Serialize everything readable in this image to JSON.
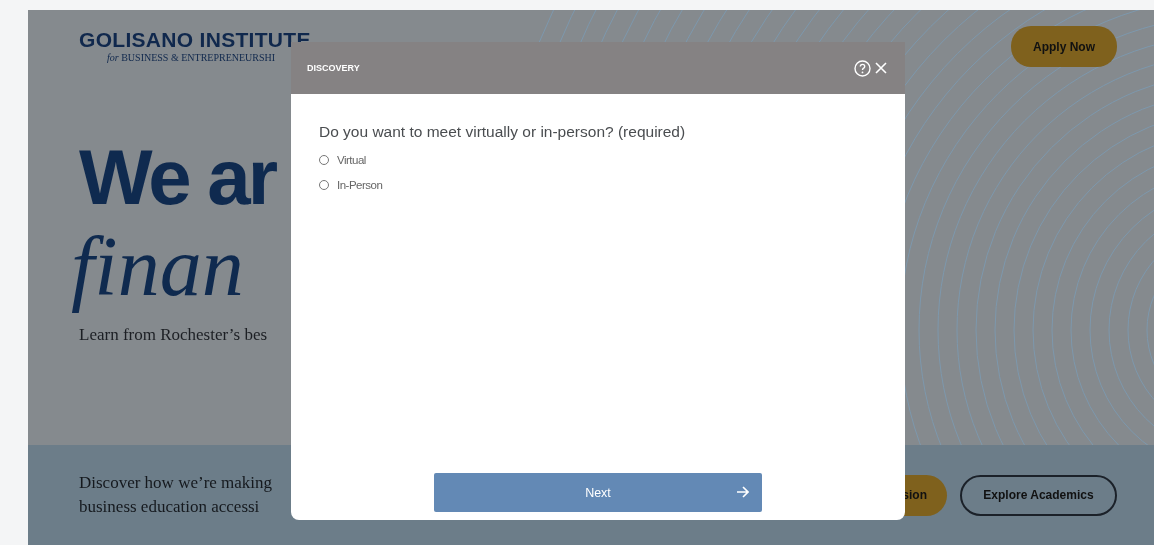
{
  "header": {
    "logo_title": "GOLISANO INSTITUTE",
    "logo_subtitle": "*for* BUSINESS & ENTREPRENEURSHI",
    "apply_button": "Apply Now"
  },
  "hero": {
    "headline": "We ar",
    "headline_italic": "finan",
    "subtitle": "Learn from Rochester’s bes"
  },
  "band": {
    "lines": [
      "Discover how we’re making",
      "business education accessi"
    ],
    "buttons": [
      {
        "label": "sion",
        "kind": "filled"
      },
      {
        "label": "Explore Academics",
        "kind": "outline"
      }
    ]
  },
  "modal": {
    "title": "DISCOVERY",
    "question": "Do you want to meet virtually or in-person? (required)",
    "options": [
      {
        "label": "Virtual",
        "selected": false
      },
      {
        "label": "In-Person",
        "selected": false
      }
    ],
    "next_button": "Next"
  }
}
